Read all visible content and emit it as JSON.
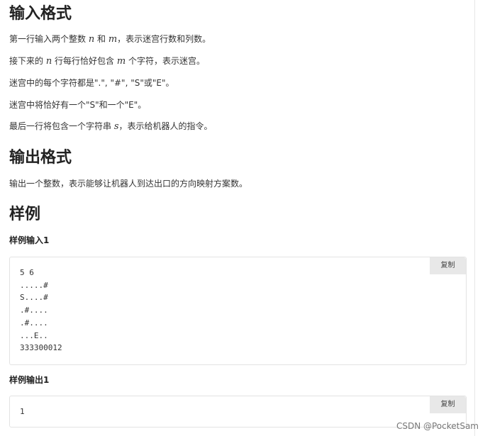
{
  "input_section": {
    "heading": "输入格式",
    "line1": {
      "before_n": "第一行输入两个整数 ",
      "n": "n",
      "between": " 和 ",
      "m": "m",
      "after": "，表示迷宫行数和列数。"
    },
    "line2": {
      "before": "接下来的 ",
      "n": "n",
      "middle": " 行每行恰好包含 ",
      "m": "m",
      "after": " 个字符，表示迷宫。"
    },
    "line3": "迷宫中的每个字符都是\".\", \"#\", \"S\"或\"E\"。",
    "line4": "迷宫中将恰好有一个\"S\"和一个\"E\"。",
    "line5": {
      "before": "最后一行将包含一个字符串 ",
      "s": "s",
      "after": "，表示给机器人的指令。"
    }
  },
  "output_section": {
    "heading": "输出格式",
    "text": "输出一个整数，表示能够让机器人到达出口的方向映射方案数。"
  },
  "sample_section": {
    "heading": "样例",
    "input_label": "样例输入1",
    "input_code": "5 6\n.....#\nS....#\n.#....\n.#....\n...E..\n333300012",
    "output_label": "样例输出1",
    "output_code": "1",
    "copy_label": "复制"
  },
  "watermark": "CSDN @PocketSam"
}
